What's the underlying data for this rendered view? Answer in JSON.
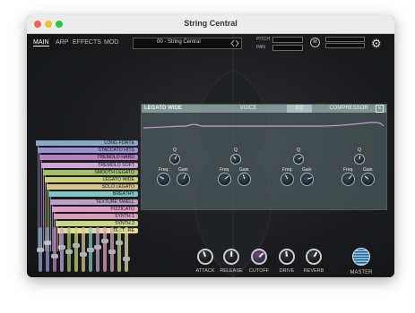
{
  "window": {
    "title": "String Central"
  },
  "nav": {
    "tabs": [
      "MAIN",
      "ARP",
      "EFFECTS",
      "MOD"
    ]
  },
  "preset": {
    "name": "00 - String Central"
  },
  "header": {
    "pitch_label": "PITCH",
    "pan_label": "PAN",
    "m_label": "M"
  },
  "articulations": [
    {
      "label": "LONG FORTE",
      "color": "#8aa7c9"
    },
    {
      "label": "STACCATO HITS",
      "color": "#9a8fd0"
    },
    {
      "label": "TREMOLO HARD",
      "color": "#b67fc2"
    },
    {
      "label": "TREMOLO SOFT",
      "color": "#c9a7d8"
    },
    {
      "label": "SMOOTH LEGATO",
      "color": "#a7bf6a"
    },
    {
      "label": "LEGATO WIDE",
      "color": "#c9cf7a"
    },
    {
      "label": "SOLO LEGATO",
      "color": "#d9c58c"
    },
    {
      "label": "BREATHY",
      "color": "#7fc6c2"
    },
    {
      "label": "TEXTURE SWELL",
      "color": "#b9a3c8"
    },
    {
      "label": "PIZZICATO",
      "color": "#e29ac6"
    },
    {
      "label": "SYNTH 1",
      "color": "#d6a0bb"
    },
    {
      "label": "SYNTH 2",
      "color": "#c7d58a"
    },
    {
      "label": "TEXTURE",
      "color": "#e6dc96"
    }
  ],
  "effect_panel": {
    "title": "LEGATO WIDE",
    "tabs": [
      "VOICE",
      "EQ",
      "COMPRESSOR"
    ],
    "active_tab": "EQ",
    "close_glyph": "×",
    "bands": [
      {
        "q": "Q",
        "freq": "Freq.",
        "gain": "Gain"
      },
      {
        "q": "Q",
        "freq": "Freq.",
        "gain": "Gain"
      },
      {
        "q": "Q",
        "freq": "Freq.",
        "gain": "Gain"
      },
      {
        "q": "Q",
        "freq": "Freq.",
        "gain": "Gain"
      }
    ]
  },
  "bottom_controls": [
    {
      "label": "ATTACK",
      "icon": "attack-knob"
    },
    {
      "label": "RELEASE",
      "icon": "release-knob"
    },
    {
      "label": "CUTOFF",
      "icon": "cutoff-knob"
    },
    {
      "label": "DRIVE",
      "icon": "drive-knob"
    },
    {
      "label": "REVERB",
      "icon": "reverb-knob"
    }
  ],
  "master": {
    "label": "MASTER"
  },
  "colors": {
    "accent": "#b67fc2",
    "panel": "#5c6e70",
    "tab_active": "#dcefef"
  }
}
